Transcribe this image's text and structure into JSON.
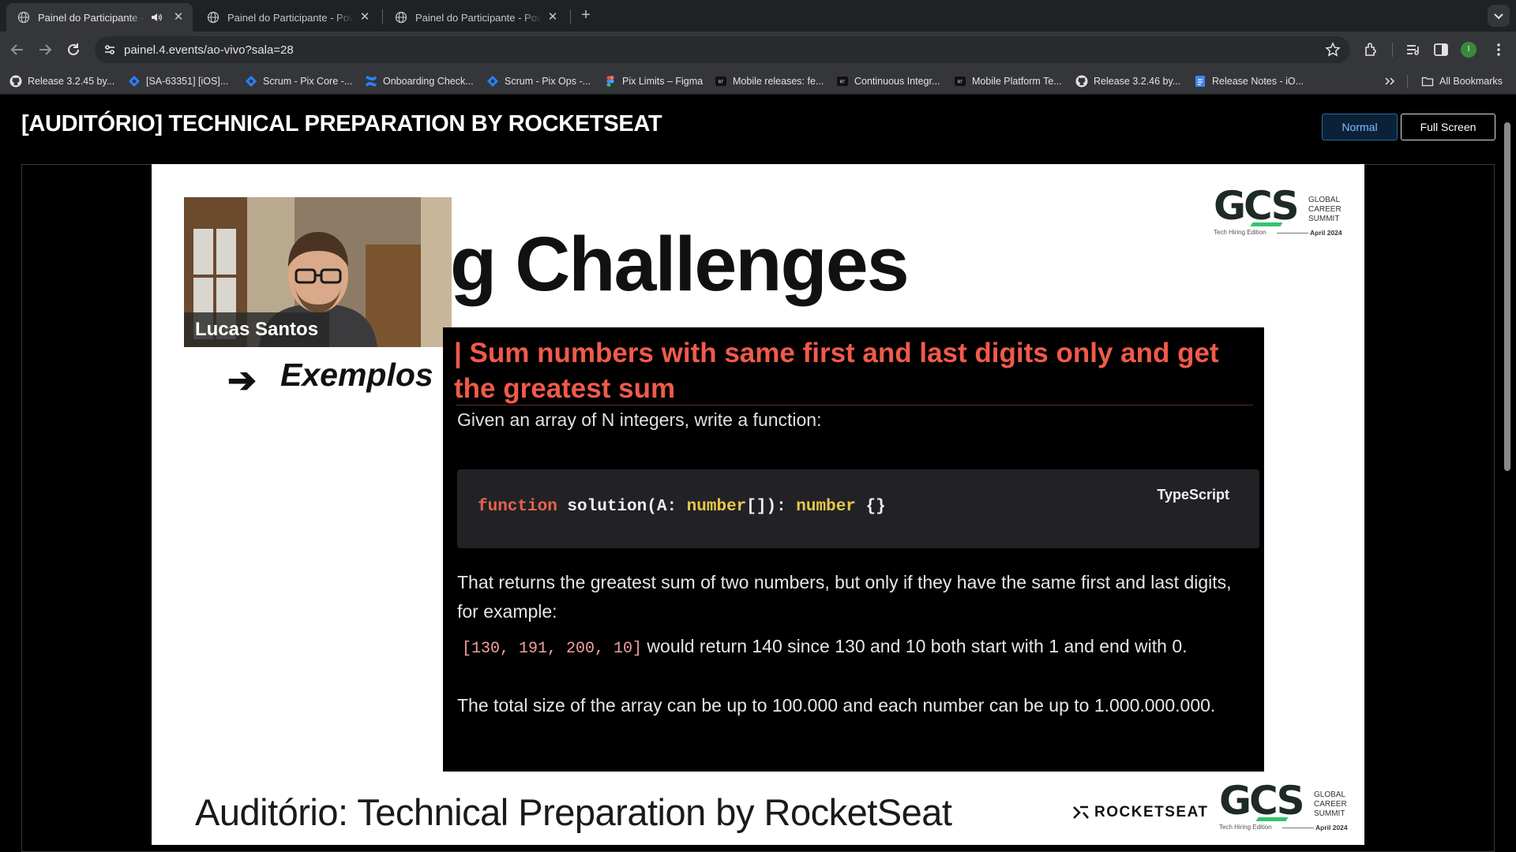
{
  "browser": {
    "tabs": [
      {
        "title": "Painel do Participante - P",
        "active": true,
        "audio": true
      },
      {
        "title": "Painel do Participante - Powe",
        "active": false,
        "audio": false
      },
      {
        "title": "Painel do Participante - Powe",
        "active": false,
        "audio": false
      }
    ],
    "url": "painel.4.events/ao-vivo?sala=28",
    "avatar_letter": "I",
    "bookmarks": [
      {
        "label": "Release 3.2.45 by...",
        "icon": "github-icon"
      },
      {
        "label": "[SA-63351] [iOS]...",
        "icon": "jira-icon"
      },
      {
        "label": "Scrum - Pix Core -...",
        "icon": "jira-icon"
      },
      {
        "label": "Onboarding Check...",
        "icon": "confluence-icon"
      },
      {
        "label": "Scrum - Pix Ops -...",
        "icon": "jira-icon"
      },
      {
        "label": "Pix Limits – Figma",
        "icon": "figma-icon"
      },
      {
        "label": "Mobile releases: fe...",
        "icon": "app-icon"
      },
      {
        "label": "Continuous Integr...",
        "icon": "app-icon"
      },
      {
        "label": "Mobile Platform Te...",
        "icon": "app-icon"
      },
      {
        "label": "Release 3.2.46 by...",
        "icon": "github-icon"
      },
      {
        "label": "Release Notes - iO...",
        "icon": "docs-icon"
      }
    ],
    "all_bookmarks_label": "All Bookmarks"
  },
  "page": {
    "title": "[AUDITÓRIO] TECHNICAL PREPARATION BY ROCKETSEAT",
    "normal_button": "Normal",
    "fullscreen_button": "Full Screen"
  },
  "slide": {
    "speaker_name": "Lucas Santos",
    "heading_fragment": "g Challenges",
    "exemplos": "Exemplos",
    "arrow": "➔",
    "gcs_text": "GCS",
    "gcs_lines": [
      "GLOBAL",
      "CAREER",
      "SUMMIT"
    ],
    "gcs_edition": "Tech Hiring Edition",
    "gcs_date": "April 2024",
    "problem": {
      "title": "| Sum numbers with same first and last digits only and get the greatest sum",
      "intro": "Given an array of N integers, write a function:",
      "code_kw": "function",
      "code_name": " solution(A: ",
      "code_type1": "number",
      "code_mid": "[]): ",
      "code_type2": "number",
      "code_end": " {}",
      "code_lang": "TypeScript",
      "para1": "That returns the greatest sum of two numbers, but only if they have the same first and last digits, for example:",
      "example_code": "[130, 191, 200, 10]",
      "example_text": " would return 140 since 130 and 10 both start with 1 and end with 0.",
      "para3": "The total size of the array can be up to 100.000 and each number can be up to 1.000.000.000."
    },
    "bottom_title": "Auditório: Technical Preparation by RocketSeat",
    "rocketseat_label": "ROCKETSEAT"
  }
}
